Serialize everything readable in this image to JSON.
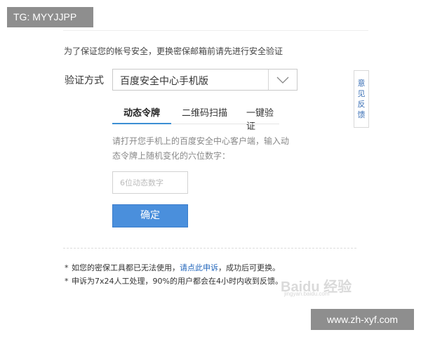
{
  "overlay": {
    "tg_label": "TG: MYYJJPP",
    "site_label": "www.zh-xyf.com"
  },
  "intro_text": "为了保证您的帐号安全，更换密保邮箱前请先进行安全验证",
  "verify": {
    "method_label": "验证方式",
    "selected_method": "百度安全中心手机版"
  },
  "tabs": [
    {
      "label": "动态令牌",
      "active": true
    },
    {
      "label": "二维码扫描",
      "active": false
    },
    {
      "label": "一键验证",
      "active": false
    }
  ],
  "instruction": "请打开您手机上的百度安全中心客户端，输入动态令牌上随机变化的六位数字：",
  "code_input": {
    "value": "",
    "placeholder": "6位动态数字"
  },
  "confirm_label": "确定",
  "notes": {
    "line1_prefix": "如您的密保工具都已无法使用，",
    "line1_link": "请点此申诉",
    "line1_suffix": "，成功后可更换。",
    "line2": "申诉为7x24人工处理，90%的用户都会在4小时内收到反馈。"
  },
  "feedback_chars": [
    "意",
    "见",
    "反",
    "馈"
  ],
  "watermark": {
    "brand": "Baidu 经验",
    "url": "jingyan.baidu.com"
  },
  "colors": {
    "accent": "#3c8fd4",
    "button": "#4a8fdc",
    "link": "#2266bb"
  }
}
